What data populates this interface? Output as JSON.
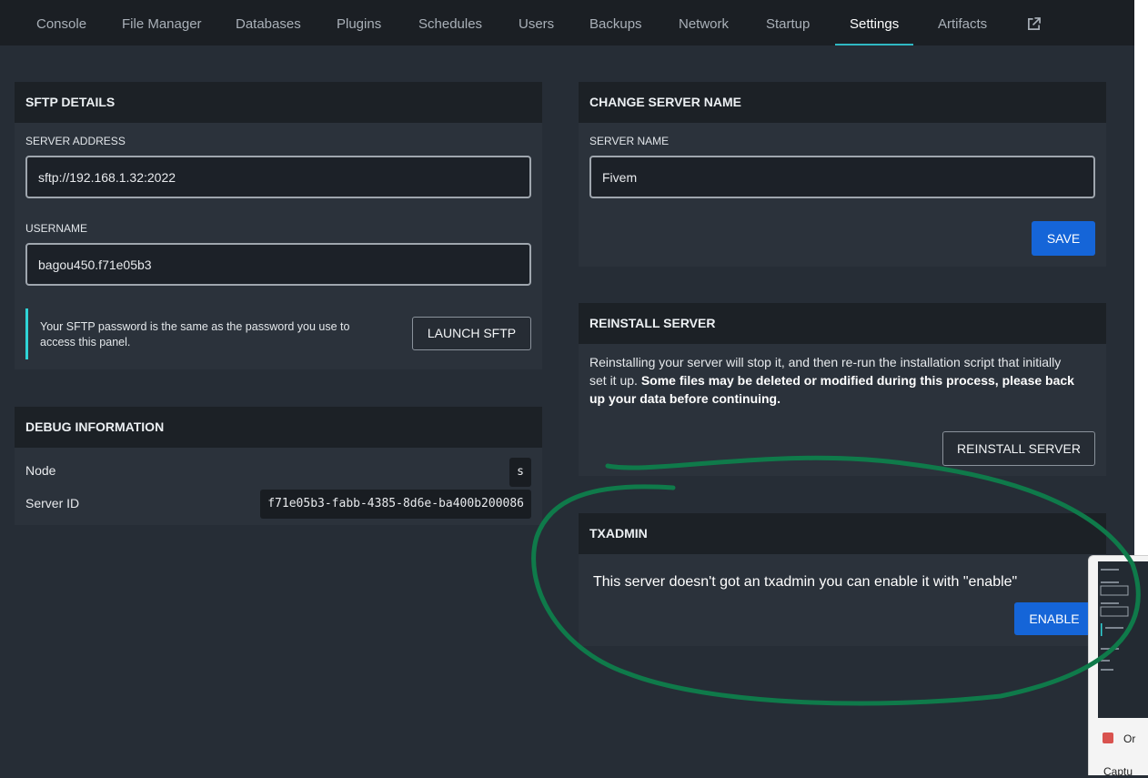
{
  "nav": {
    "tabs": [
      "Console",
      "File Manager",
      "Databases",
      "Plugins",
      "Schedules",
      "Users",
      "Backups",
      "Network",
      "Startup",
      "Settings",
      "Artifacts"
    ],
    "active": "Settings",
    "external_icon": "external-link-icon"
  },
  "sftp": {
    "title": "SFTP DETAILS",
    "server_address_label": "SERVER ADDRESS",
    "server_address": "sftp://192.168.1.32:2022",
    "username_label": "USERNAME",
    "username": "bagou450.f71e05b3",
    "note": "Your SFTP password is the same as the password you use to access this panel.",
    "launch_label": "LAUNCH SFTP"
  },
  "debug": {
    "title": "DEBUG INFORMATION",
    "node_label": "Node",
    "node_value": "s",
    "server_id_label": "Server ID",
    "server_id_value": "f71e05b3-fabb-4385-8d6e-ba400b200086"
  },
  "change_name": {
    "title": "CHANGE SERVER NAME",
    "label": "SERVER NAME",
    "value": "Fivem",
    "save_label": "SAVE"
  },
  "reinstall": {
    "title": "REINSTALL SERVER",
    "text_normal": "Reinstalling your server will stop it, and then re-run the installation script that initially set it up.",
    "text_bold": "Some files may be deleted or modified during this process, please back up your data before continuing.",
    "button_label": "REINSTALL SERVER"
  },
  "txadmin": {
    "title": "TXADMIN",
    "message": "This server doesn't got an txadmin you can enable it with \"enable\"",
    "button_label": "ENABLE"
  },
  "taskbar_popup": {
    "line1": "Or",
    "line2": "Captu"
  },
  "colors": {
    "background": "#262d36",
    "nav": "#1b1f24",
    "accent": "#2fb8c3",
    "primary_button": "#1565d8",
    "annotation": "#0f7a4a"
  }
}
